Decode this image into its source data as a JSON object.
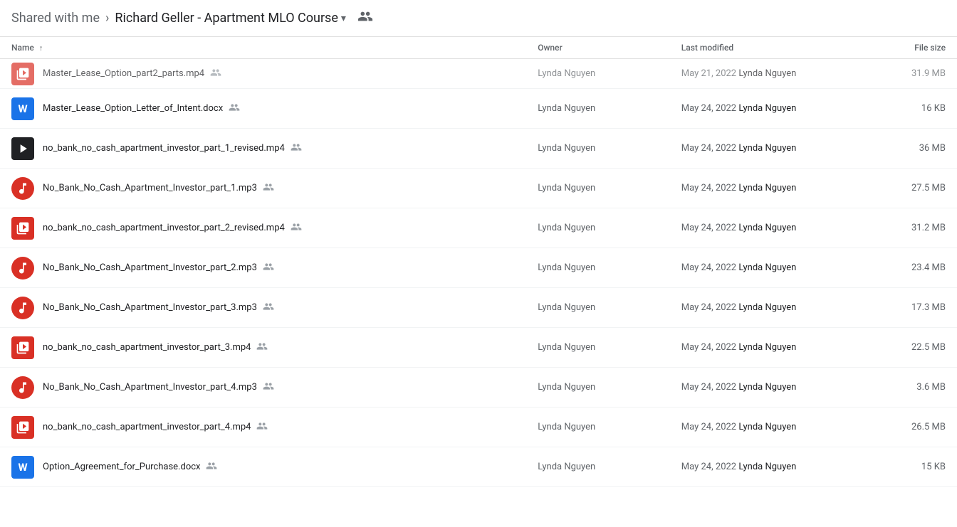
{
  "header": {
    "shared_label": "Shared with me",
    "chevron": "›",
    "folder_name": "Richard Geller - Apartment MLO Course",
    "dropdown_symbol": "▾",
    "people_icon": "👥"
  },
  "table": {
    "columns": {
      "name": "Name",
      "sort_icon": "↑",
      "owner": "Owner",
      "last_modified": "Last modified",
      "file_size": "File size"
    },
    "rows": [
      {
        "id": "row-partial",
        "icon_type": "video-red",
        "name": "Master_Lease_Option_part2_parts.mp4",
        "shared": true,
        "owner": "Lynda Nguyen",
        "modified_date": "May 21, 2022",
        "modified_by": "Lynda Nguyen",
        "size": "31.9 MB",
        "partial": true
      },
      {
        "id": "row-word-1",
        "icon_type": "word",
        "name": "Master_Lease_Option_Letter_of_Intent.docx",
        "shared": true,
        "owner": "Lynda Nguyen",
        "modified_date": "May 24, 2022",
        "modified_by": "Lynda Nguyen",
        "size": "16 KB"
      },
      {
        "id": "row-mp4-1",
        "icon_type": "video-dark",
        "name": "no_bank_no_cash_apartment_investor_part_1_revised.mp4",
        "shared": true,
        "owner": "Lynda Nguyen",
        "modified_date": "May 24, 2022",
        "modified_by": "Lynda Nguyen",
        "size": "36 MB"
      },
      {
        "id": "row-mp3-1",
        "icon_type": "audio",
        "name": "No_Bank_No_Cash_Apartment_Investor_part_1.mp3",
        "shared": true,
        "owner": "Lynda Nguyen",
        "modified_date": "May 24, 2022",
        "modified_by": "Lynda Nguyen",
        "size": "27.5 MB"
      },
      {
        "id": "row-mp4-2",
        "icon_type": "video-red",
        "name": "no_bank_no_cash_apartment_investor_part_2_revised.mp4",
        "shared": true,
        "owner": "Lynda Nguyen",
        "modified_date": "May 24, 2022",
        "modified_by": "Lynda Nguyen",
        "size": "31.2 MB"
      },
      {
        "id": "row-mp3-2",
        "icon_type": "audio",
        "name": "No_Bank_No_Cash_Apartment_Investor_part_2.mp3",
        "shared": true,
        "owner": "Lynda Nguyen",
        "modified_date": "May 24, 2022",
        "modified_by": "Lynda Nguyen",
        "size": "23.4 MB"
      },
      {
        "id": "row-mp3-3",
        "icon_type": "audio",
        "name": "No_Bank_No_Cash_Apartment_Investor_part_3.mp3",
        "shared": true,
        "owner": "Lynda Nguyen",
        "modified_date": "May 24, 2022",
        "modified_by": "Lynda Nguyen",
        "size": "17.3 MB"
      },
      {
        "id": "row-mp4-3",
        "icon_type": "video-red",
        "name": "no_bank_no_cash_apartment_investor_part_3.mp4",
        "shared": true,
        "owner": "Lynda Nguyen",
        "modified_date": "May 24, 2022",
        "modified_by": "Lynda Nguyen",
        "size": "22.5 MB"
      },
      {
        "id": "row-mp3-4",
        "icon_type": "audio",
        "name": "No_Bank_No_Cash_Apartment_Investor_part_4.mp3",
        "shared": true,
        "owner": "Lynda Nguyen",
        "modified_date": "May 24, 2022",
        "modified_by": "Lynda Nguyen",
        "size": "3.6 MB"
      },
      {
        "id": "row-mp4-4",
        "icon_type": "video-red",
        "name": "no_bank_no_cash_apartment_investor_part_4.mp4",
        "shared": true,
        "owner": "Lynda Nguyen",
        "modified_date": "May 24, 2022",
        "modified_by": "Lynda Nguyen",
        "size": "26.5 MB"
      },
      {
        "id": "row-word-2",
        "icon_type": "word",
        "name": "Option_Agreement_for_Purchase.docx",
        "shared": true,
        "owner": "Lynda Nguyen",
        "modified_date": "May 24, 2022",
        "modified_by": "Lynda Nguyen",
        "size": "15 KB"
      }
    ]
  }
}
